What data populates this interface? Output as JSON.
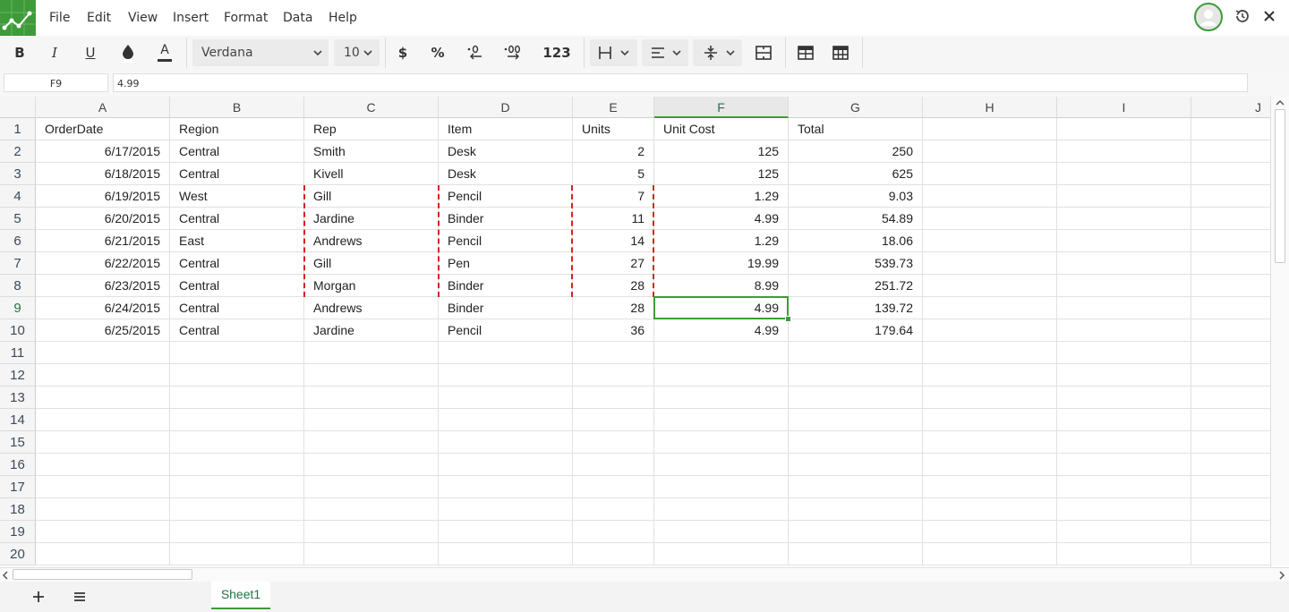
{
  "menu": [
    "File",
    "Edit",
    "View",
    "Insert",
    "Format",
    "Data",
    "Help"
  ],
  "toolbar": {
    "bold": "B",
    "italic": "I",
    "underline": "U",
    "font_color_glyph": "A",
    "font_family": "Verdana",
    "font_size": "10",
    "currency": "$",
    "percent": "%",
    "number_format": "123",
    "accent_color": "#3f9a3a"
  },
  "formula_bar": {
    "cell_ref": "F9",
    "value": "4.99"
  },
  "columns": [
    "A",
    "B",
    "C",
    "D",
    "E",
    "F",
    "G",
    "H",
    "I",
    "J"
  ],
  "selected": {
    "column": "F",
    "row": "9"
  },
  "rows": [
    {
      "num": "1",
      "cells": [
        "OrderDate",
        "Region",
        "Rep",
        "Item",
        "Units",
        "Unit Cost",
        "Total"
      ]
    },
    {
      "num": "2",
      "cells": [
        "6/17/2015",
        "Central",
        "Smith",
        "Desk",
        "2",
        "125",
        "250"
      ]
    },
    {
      "num": "3",
      "cells": [
        "6/18/2015",
        "Central",
        "Kivell",
        "Desk",
        "5",
        "125",
        "625"
      ]
    },
    {
      "num": "4",
      "cells": [
        "6/19/2015",
        "West",
        "Gill",
        "Pencil",
        "7",
        "1.29",
        "9.03"
      ]
    },
    {
      "num": "5",
      "cells": [
        "6/20/2015",
        "Central",
        "Jardine",
        "Binder",
        "11",
        "4.99",
        "54.89"
      ]
    },
    {
      "num": "6",
      "cells": [
        "6/21/2015",
        "East",
        "Andrews",
        "Pencil",
        "14",
        "1.29",
        "18.06"
      ]
    },
    {
      "num": "7",
      "cells": [
        "6/22/2015",
        "Central",
        "Gill",
        "Pen",
        "27",
        "19.99",
        "539.73"
      ]
    },
    {
      "num": "8",
      "cells": [
        "6/23/2015",
        "Central",
        "Morgan",
        "Binder",
        "28",
        "8.99",
        "251.72"
      ]
    },
    {
      "num": "9",
      "cells": [
        "6/24/2015",
        "Central",
        "Andrews",
        "Binder",
        "28",
        "4.99",
        "139.72"
      ]
    },
    {
      "num": "10",
      "cells": [
        "6/25/2015",
        "Central",
        "Jardine",
        "Pencil",
        "36",
        "4.99",
        "179.64"
      ]
    },
    {
      "num": "11",
      "cells": []
    },
    {
      "num": "12",
      "cells": []
    },
    {
      "num": "13",
      "cells": []
    },
    {
      "num": "14",
      "cells": []
    },
    {
      "num": "15",
      "cells": []
    },
    {
      "num": "16",
      "cells": []
    },
    {
      "num": "17",
      "cells": []
    },
    {
      "num": "18",
      "cells": []
    },
    {
      "num": "19",
      "cells": []
    },
    {
      "num": "20",
      "cells": []
    }
  ],
  "sheets": [
    "Sheet1"
  ]
}
